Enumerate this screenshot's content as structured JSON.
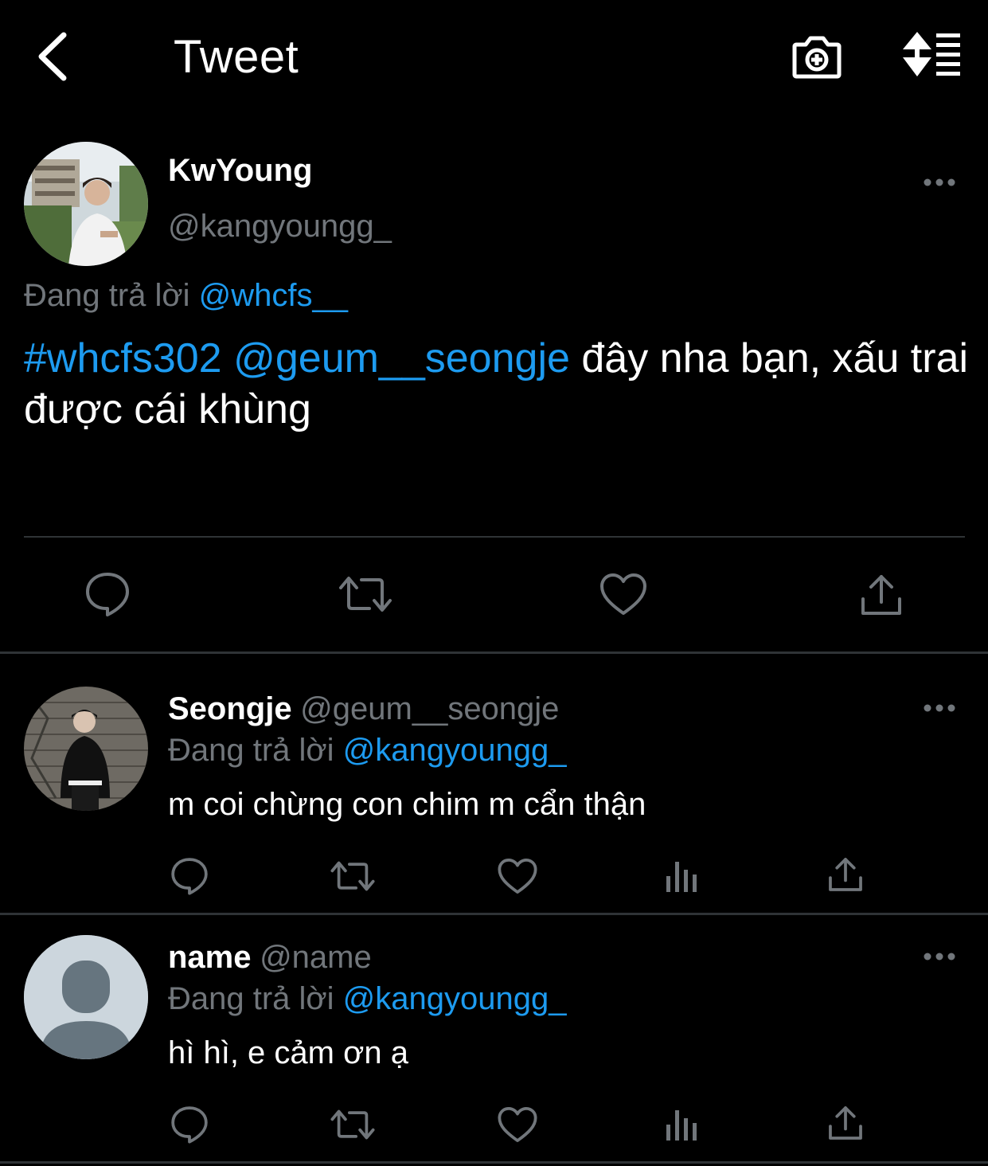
{
  "header": {
    "title": "Tweet",
    "back_icon": "chevron-left-icon",
    "camera_icon": "camera-add-icon",
    "sort_icon": "sort-icon"
  },
  "tweet": {
    "display_name": "KwYoung",
    "handle": "@kangyoungg_",
    "reply_prefix": "Đang trả lời",
    "reply_handle": "@whcfs__",
    "hashtag": "#whcfs302",
    "mention": "@geum__seongje",
    "text": " đây nha bạn, xấu trai được cái khùng",
    "actions": [
      "reply-icon",
      "retweet-icon",
      "like-icon",
      "share-icon"
    ]
  },
  "replies": [
    {
      "display_name": "Seongje",
      "handle": "@geum__seongje",
      "reply_prefix": "Đang trả lời",
      "reply_handle": "@kangyoungg_",
      "text": "m coi chừng con chim m cẩn thận"
    },
    {
      "display_name": "name",
      "handle": "@name",
      "reply_prefix": "Đang trả lời",
      "reply_handle": "@kangyoungg_",
      "text": "hì hì, e cảm ơn ạ"
    }
  ],
  "colors": {
    "background": "#000000",
    "link": "#1d9bf0",
    "muted": "#71767b",
    "divider": "#2f3336"
  }
}
